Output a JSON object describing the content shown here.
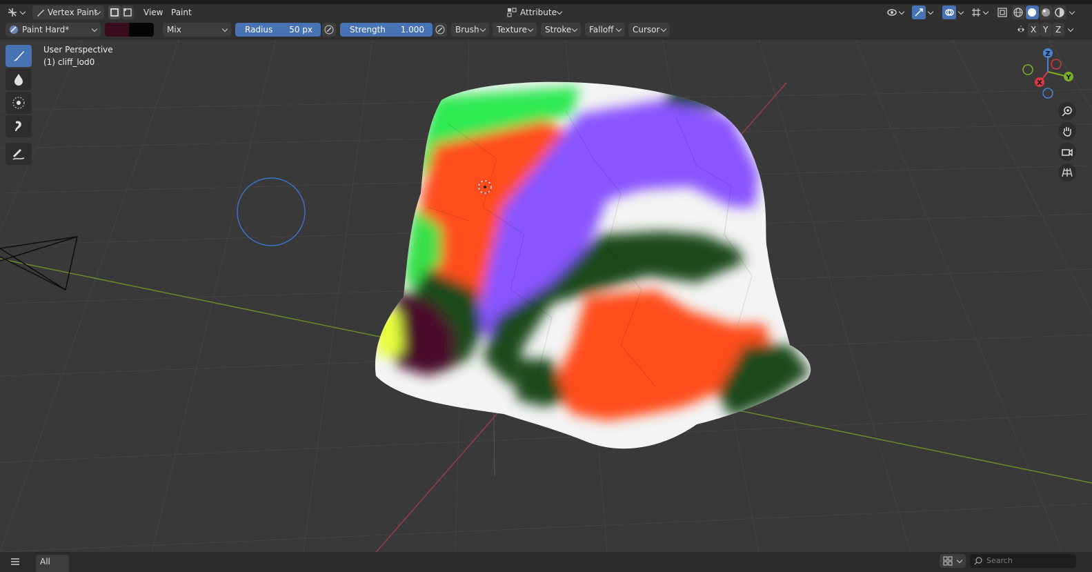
{
  "header": {
    "editor_type_icon": "3d-viewport-icon",
    "mode_label": "Vertex Paint",
    "menu_view": "View",
    "menu_paint": "Paint",
    "attribute_label": "Attribute"
  },
  "tool_header": {
    "brush_name": "Paint Hard*",
    "primary_color": "#3a0a1e",
    "secondary_color": "#050505",
    "blend_mode": "Mix",
    "radius_label": "Radius",
    "radius_value": "50 px",
    "strength_label": "Strength",
    "strength_value": "1.000",
    "brush_menu": "Brush",
    "texture_menu": "Texture",
    "stroke_menu": "Stroke",
    "falloff_menu": "Falloff",
    "cursor_menu": "Cursor",
    "axis_x": "X",
    "axis_y": "Y",
    "axis_z": "Z"
  },
  "viewport": {
    "view_name": "User Perspective",
    "object_name": "(1) cliff_lod0",
    "gizmo_labels": {
      "x": "X",
      "y": "Y",
      "z": "Z"
    }
  },
  "toolbar": {
    "tools": [
      "draw-brush-icon",
      "blur-brush-icon",
      "average-brush-icon",
      "smear-brush-icon",
      "annotate-icon"
    ],
    "active_tool": "draw-brush-icon"
  },
  "footer": {
    "filter_label": "All",
    "search_placeholder": "Search"
  },
  "colors": {
    "accent": "#4772b3",
    "paint_green": "#2dea53",
    "paint_orange": "#ff4d1f",
    "paint_purple": "#8855ff",
    "paint_dark_green": "#1b4a1f",
    "paint_maroon": "#4a0a2a",
    "paint_yellow": "#e6ff3a"
  }
}
